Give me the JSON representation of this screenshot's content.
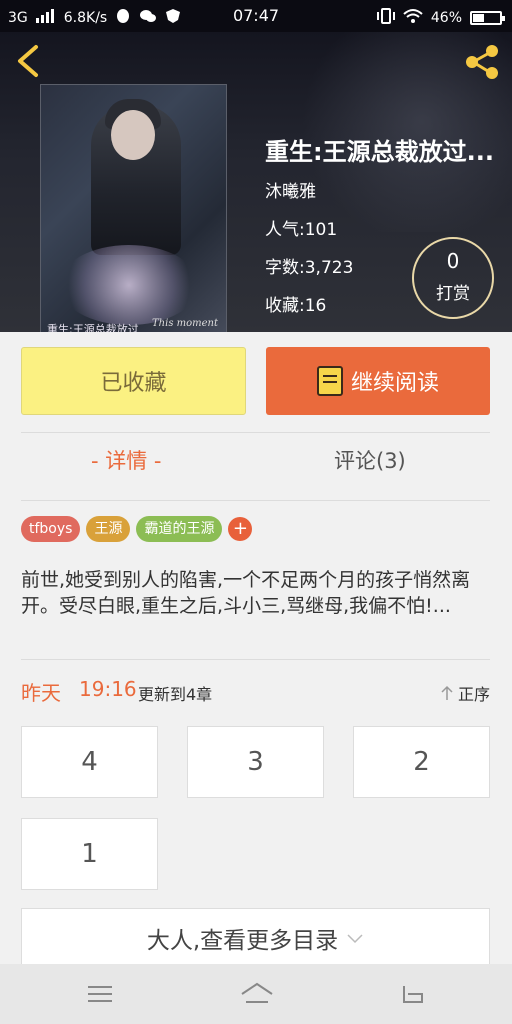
{
  "status_bar": {
    "network": "3G",
    "speed": "6.8K/s",
    "time": "07:47",
    "battery": "46%"
  },
  "book": {
    "cover_title": "重生:王源总裁放过",
    "cover_caption": "This moment",
    "title": "重生:王源总裁放过...",
    "author": "沐曦雅",
    "popularity": "人气:101",
    "word_count": "字数:3,723",
    "favorites": "收藏:16"
  },
  "tip": {
    "count": "0",
    "label": "打赏"
  },
  "actions": {
    "favorited": "已收藏",
    "continue_reading": "继续阅读"
  },
  "tabs": {
    "detail": "- 详情 -",
    "comments": "评论(3)"
  },
  "tags": [
    {
      "label": "tfboys",
      "color": "#e06a5e"
    },
    {
      "label": "王源",
      "color": "#d9a13a"
    },
    {
      "label": "霸道的王源",
      "color": "#8cbd54"
    },
    {
      "label": "+",
      "color": "#e8603a"
    }
  ],
  "description": "前世,她受到别人的陷害,一个不足两个月的孩子悄然离开。受尽白眼,重生之后,斗小三,骂继母,我偏不怕!...",
  "update": {
    "day": "昨天",
    "time": "19:16",
    "text": "更新到4章",
    "order": "正序"
  },
  "chapters": [
    "4",
    "3",
    "2",
    "1"
  ],
  "more_catalog": "大人,查看更多目录",
  "colors": {
    "accent": "#ea6a3c",
    "favorite_bg": "#fbf182"
  }
}
